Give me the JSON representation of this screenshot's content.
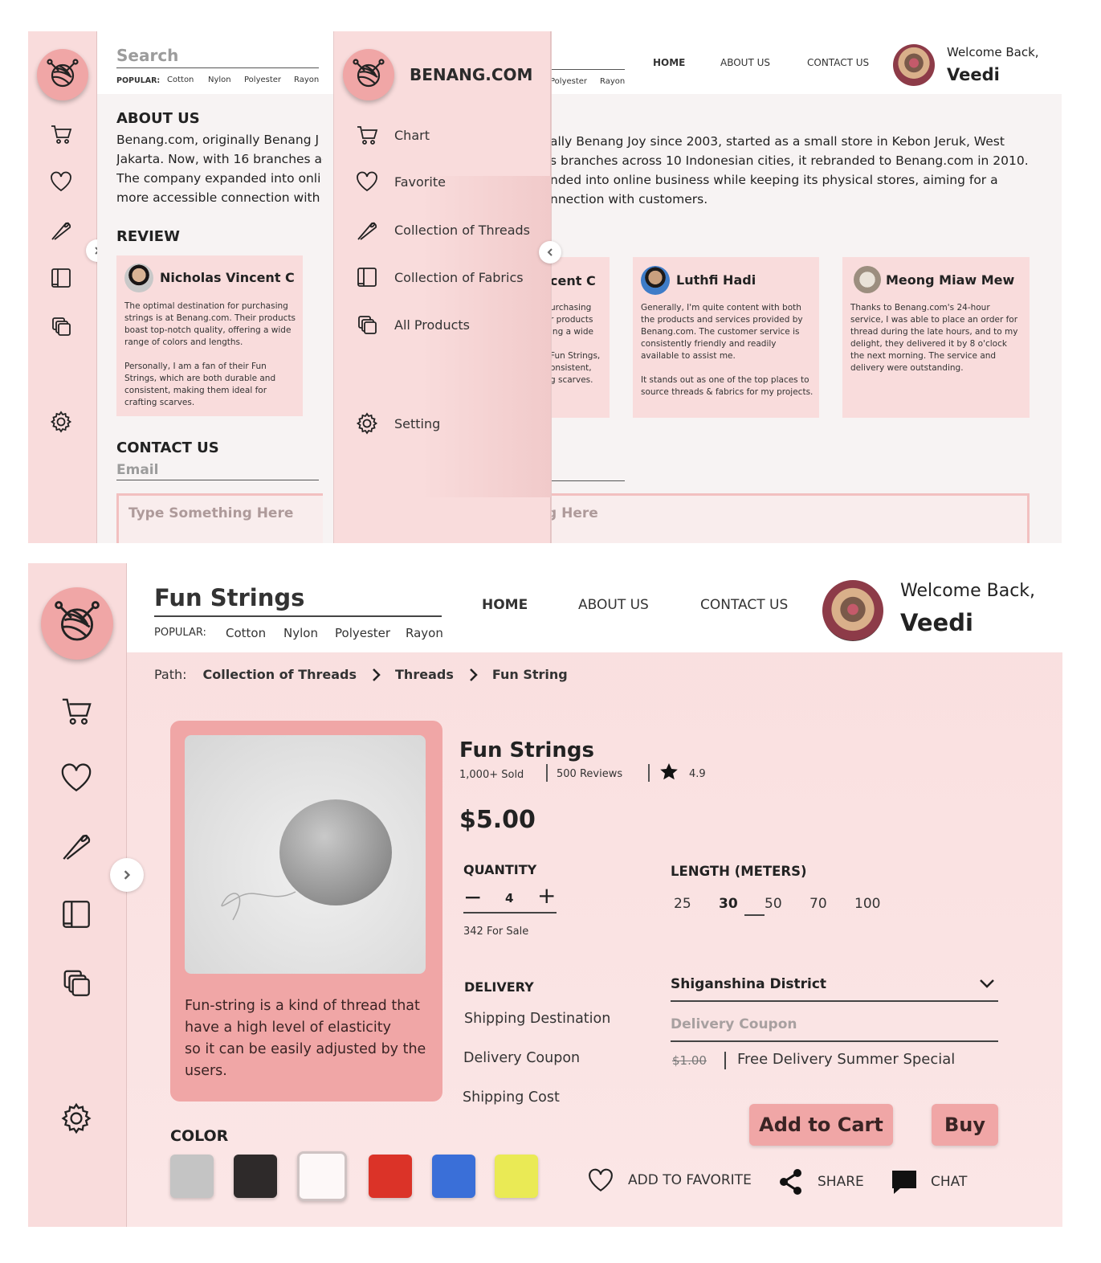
{
  "top": {
    "search_placeholder": "Search",
    "popular_label": "POPULAR:",
    "popular": [
      "Cotton",
      "Nylon",
      "Polyester",
      "Rayon"
    ],
    "nav": {
      "home": "HOME",
      "about": "ABOUT US",
      "contact": "CONTACT US"
    },
    "welcome": "Welcome Back,",
    "user": "Veedi",
    "about_title": "ABOUT US",
    "about_lines_left": [
      "Benang.com, originally Benang J",
      "Jakarta. Now, with 16 branches ac",
      "The company expanded into onli",
      "more accessible connection with"
    ],
    "about_lines_right": [
      "ally Benang Joy since 2003, started as a small store in Kebon Jeruk, West",
      "s branches across 10 Indonesian cities, it rebranded to Benang.com in 2010.",
      "nded into online business while keeping its physical stores, aiming for a",
      "nnection with customers."
    ],
    "review_title": "REVIEW",
    "reviews": [
      {
        "name": "Nicholas Vincent C",
        "text": "The optimal destination for purchasing strings is at Benang.com. Their products boast top-notch quality, offering a wide range of colors and lengths.",
        "text2": "Personally, I am a fan of their Fun Strings, which are both durable and consistent, making them ideal for crafting scarves."
      },
      {
        "name": "Luthfi Hadi",
        "text": "Generally, I'm quite content with both the products and services provided by Benang.com. The customer service is consistently friendly and readily available to assist me.",
        "text2": "It stands out as one of the top places to source threads & fabrics for my projects."
      },
      {
        "name": "Meong Miaw Mew",
        "text": "Thanks to Benang.com's 24-hour service, I was able to place an order for thread during the late hours, and to my delight, they delivered it by 8 o'clock the next morning. The service and delivery were outstanding.",
        "text2": ""
      }
    ],
    "review_partial_name": "cent C",
    "review_partial_lines": [
      "urchasing",
      "r products",
      "ing a wide",
      "",
      "Fun Strings,",
      "onsistent,",
      "g scarves."
    ],
    "contact_title": "CONTACT US",
    "email_placeholder": "Email",
    "message_placeholder": "Type Something Here",
    "message_partial": "g Here",
    "brand": "BENANG.COM",
    "menu": [
      "Chart",
      "Favorite",
      "Collection of Threads",
      "Collection of Fabrics",
      "All Products"
    ],
    "menu_setting": "Setting",
    "partial_popular": [
      "Polyester",
      "Rayon"
    ]
  },
  "bottom": {
    "search_value": "Fun Strings",
    "popular_label": "POPULAR:",
    "popular": [
      "Cotton",
      "Nylon",
      "Polyester",
      "Rayon"
    ],
    "nav": {
      "home": "HOME",
      "about": "ABOUT US",
      "contact": "CONTACT US"
    },
    "welcome": "Welcome Back,",
    "user": "Veedi",
    "path_label": "Path:",
    "path": [
      "Collection of Threads",
      "Threads",
      "Fun String"
    ],
    "product": {
      "title": "Fun Strings",
      "sold": "1,000+ Sold",
      "reviews": "500 Reviews",
      "rating": "4.9",
      "price": "$5.00",
      "description": [
        "Fun-string is a kind of thread that",
        "have a high level of elasticity",
        "so it can be easily adjusted by the",
        "users."
      ]
    },
    "quantity_label": "QUANTITY",
    "quantity_value": "4",
    "for_sale": "342 For Sale",
    "length_label": "LENGTH (METERS)",
    "lengths": [
      "25",
      "30",
      "50",
      "70",
      "100"
    ],
    "selected_length": "30",
    "delivery_label": "DELIVERY",
    "shipping_destination": "Shipping Destination",
    "delivery_coupon": "Delivery Coupon",
    "shipping_cost": "Shipping Cost",
    "district": "Shiganshina District",
    "coupon_placeholder": "Delivery Coupon",
    "old_cost": "$1.00",
    "free_delivery": "Free Delivery Summer Special",
    "add_to_cart": "Add to Cart",
    "buy": "Buy",
    "color_label": "COLOR",
    "colors": [
      "#c4c4c4",
      "#2e2a2a",
      "#fdf8f8",
      "#db3328",
      "#3a6fd8",
      "#eaea55"
    ],
    "add_fav": "ADD TO FAVORITE",
    "share": "SHARE",
    "chat": "CHAT"
  }
}
